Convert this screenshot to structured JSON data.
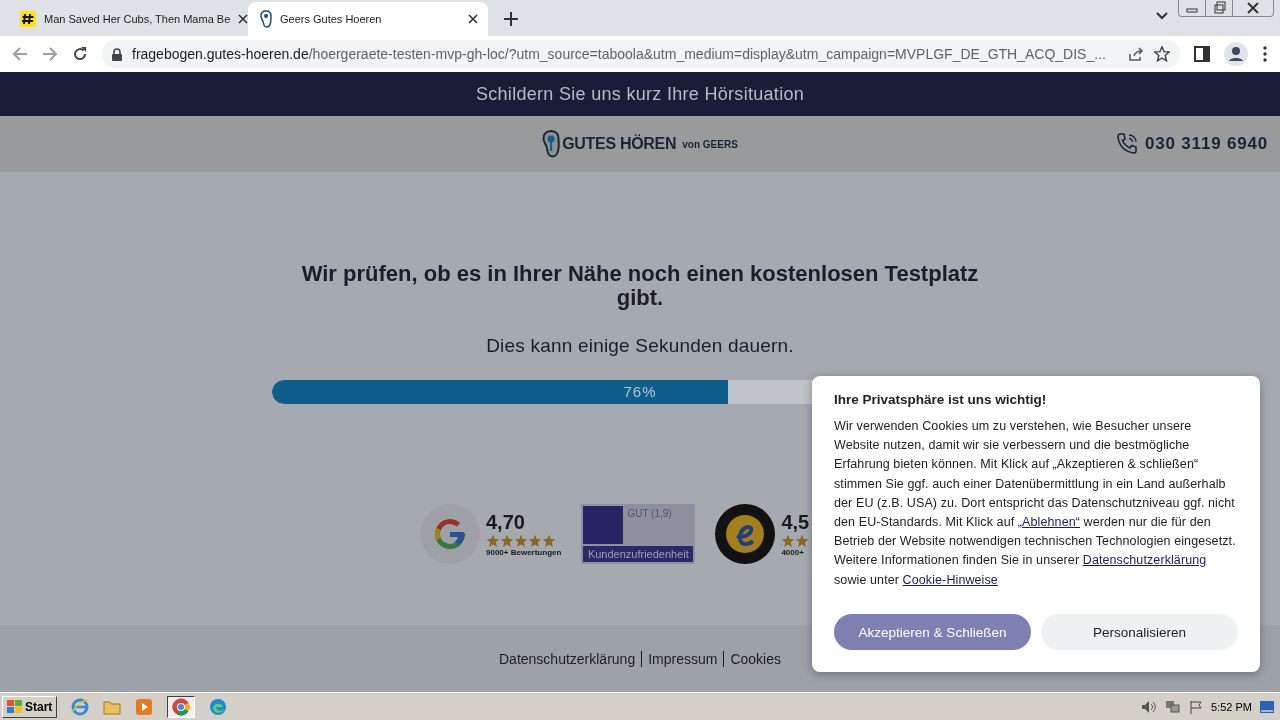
{
  "browser": {
    "tabs": [
      {
        "title": "Man Saved Her Cubs, Then Mama Be",
        "selected": false
      },
      {
        "title": "Geers Gutes Hoeren",
        "selected": true
      }
    ],
    "address": {
      "domain": "fragebogen.gutes-hoeren.de",
      "path": "/hoergeraete-testen-mvp-gh-loc/?utm_source=taboola&utm_medium=display&utm_campaign=MVPLGF_DE_GTH_ACQ_DIS_..."
    }
  },
  "page": {
    "top_banner": "Schildern Sie uns kurz Ihre Hörsituation",
    "logo": {
      "name": "GUTES HÖREN",
      "suffix": "von GEERS"
    },
    "phone": "030 3119 6940",
    "heading": "Wir prüfen, ob es in Ihrer Nähe noch einen kostenlosen Testplatz gibt.",
    "subheading": "Dies kann einige Sekunden dauern.",
    "progress": {
      "level": 0.62,
      "reading": "76%"
    },
    "ratings": [
      {
        "kind": "google",
        "score": "4,70",
        "stars": 5,
        "count": "9000+ Bewertungen"
      },
      {
        "kind": "tuv",
        "grade": "GUT (1,9)",
        "label": "Kundenzufriedenheit"
      },
      {
        "kind": "trusted",
        "score": "4,5",
        "count": "4000+"
      }
    ],
    "footer_links": [
      "Datenschutzerklärung",
      "Impressum",
      "Cookies"
    ]
  },
  "cookie_dialog": {
    "title": "Ihre Privatsphäre ist uns wichtig!",
    "text": "Wir verwenden Cookies um zu verstehen, wie Besucher unsere Website nutzen, damit wir sie verbessern und die bestmögliche Erfahrung bieten können. Mit Klick auf „Akzeptieren & schließen“ stimmen Sie ggf. auch einer Datenübermittlung in ein Land außerhalb der EU (z.B. USA) zu. Dort entspricht das Datenschutzniveau ggf. nicht den EU-Standards. Mit Klick auf ",
    "reject_link": "„Ablehnen“",
    "text_2": " werden nur die für den Betrieb der Website notwendigen technischen Technologien eingesetzt. Weitere Informationen finden Sie in unserer ",
    "privacy_link": "Datenschutzerklärung",
    "text_3": " sowie unter ",
    "cookie_link": "Cookie-Hinweise",
    "buttons": [
      {
        "label": "Akzeptieren & Schließen",
        "kind": "primary"
      },
      {
        "label": "Personalisieren",
        "kind": "secondary"
      }
    ]
  },
  "taskbar": {
    "start": "Start",
    "time": "5:52 PM"
  }
}
